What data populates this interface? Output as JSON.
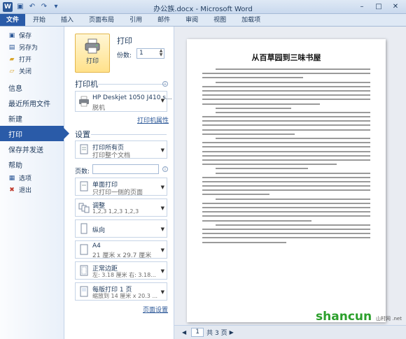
{
  "window": {
    "app_icon": "W",
    "title": "办公族.docx - Microsoft Word",
    "qat_icons": [
      "save-icon",
      "undo-icon",
      "redo-icon",
      "customize-icon"
    ],
    "controls": [
      "minimize-icon",
      "maximize-icon",
      "close-icon"
    ]
  },
  "ribbon": {
    "tabs": [
      "文件",
      "开始",
      "插入",
      "页面布局",
      "引用",
      "邮件",
      "审阅",
      "视图",
      "加载项"
    ]
  },
  "nav": {
    "commands": [
      {
        "label": "保存",
        "icon": "save-icon"
      },
      {
        "label": "另存为",
        "icon": "save-as-icon"
      },
      {
        "label": "打开",
        "icon": "open-folder-icon"
      },
      {
        "label": "关闭",
        "icon": "close-doc-icon"
      }
    ],
    "tabs_a": [
      "信息",
      "最近所用文件",
      "新建"
    ],
    "active_tab": "打印",
    "tabs_b": [
      "保存并发送",
      "帮助"
    ],
    "bottom": [
      {
        "label": "选项",
        "icon": "options-icon"
      },
      {
        "label": "退出",
        "icon": "exit-icon"
      }
    ]
  },
  "print": {
    "button": "打印",
    "heading": "打印",
    "copies_label": "份数:",
    "copies_value": "1"
  },
  "printer": {
    "heading": "打印机",
    "name": "HP Deskjet 1050 J410 s...",
    "status": "脱机",
    "properties_link": "打印机属性"
  },
  "settings": {
    "heading": "设置",
    "range": {
      "t1": "打印所有页",
      "t2": "打印整个文档"
    },
    "pages_label": "页数:",
    "sides": {
      "t1": "单面打印",
      "t2": "只打印一侧的页面"
    },
    "collate": {
      "t1": "调整",
      "t2": "1,2,3    1,2,3    1,2,3"
    },
    "orientation": {
      "t1": "纵向"
    },
    "paper": {
      "t1": "A4",
      "t2": "21 厘米 x 29.7 厘米"
    },
    "margins": {
      "t1": "正常边距",
      "t2": "左: 3.18 厘米   右: 3.18..."
    },
    "per_sheet": {
      "t1": "每版打印 1 页",
      "t2": "缩放到 14 厘米 x 20.3 ..."
    },
    "page_setup_link": "页面设置"
  },
  "preview": {
    "doc_title": "从百草园到三味书屋",
    "page_current": "1",
    "page_total": "共 3 页",
    "watermark": "shancun",
    "watermark_sub": "山村网 .net"
  }
}
